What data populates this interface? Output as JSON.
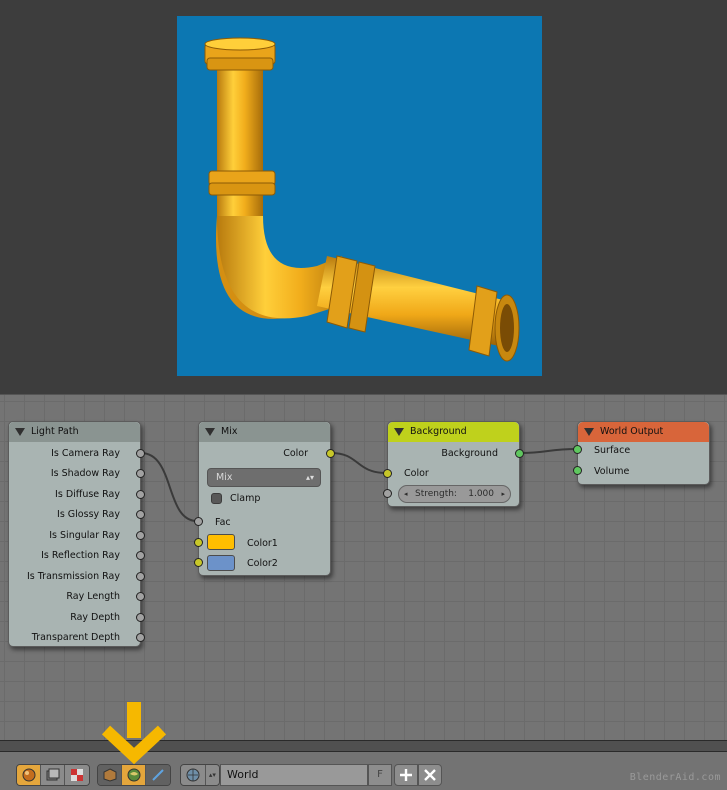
{
  "nodes": {
    "light_path": {
      "title": "Light Path",
      "outputs": [
        "Is Camera Ray",
        "Is Shadow Ray",
        "Is Diffuse Ray",
        "Is Glossy Ray",
        "Is Singular Ray",
        "Is Reflection Ray",
        "Is Transmission Ray",
        "Ray Length",
        "Ray Depth",
        "Transparent Depth"
      ]
    },
    "mix": {
      "title": "Mix",
      "output": "Color",
      "blend_type": "Mix",
      "clamp_label": "Clamp",
      "fac_label": "Fac",
      "color1_label": "Color1",
      "color2_label": "Color2",
      "color1_value": "#ffbe00",
      "color2_value": "#6c92c9"
    },
    "background": {
      "title": "Background",
      "output": "Background",
      "color_label": "Color",
      "strength_label": "Strength:",
      "strength_value": "1.000",
      "header_color": "#bfd11c"
    },
    "world_output": {
      "title": "World Output",
      "surface_label": "Surface",
      "volume_label": "Volume",
      "header_color": "#d8653a"
    }
  },
  "header": {
    "world_name": "World",
    "fake_user_label": "F",
    "watermark": "BlenderAid.com"
  },
  "colors": {
    "render_background": "#0c77b2",
    "pipe": "#f2ae1c",
    "highlight_arrow": "#f6b800",
    "active_button": "#e4a63c"
  },
  "icons": {
    "shader_type": [
      "object-shader-icon",
      "world-shader-icon",
      "texture-shader-icon"
    ],
    "shader_source": [
      "object-icon",
      "world-icon",
      "brush-icon"
    ],
    "world_browse": "world-browse-icon"
  }
}
